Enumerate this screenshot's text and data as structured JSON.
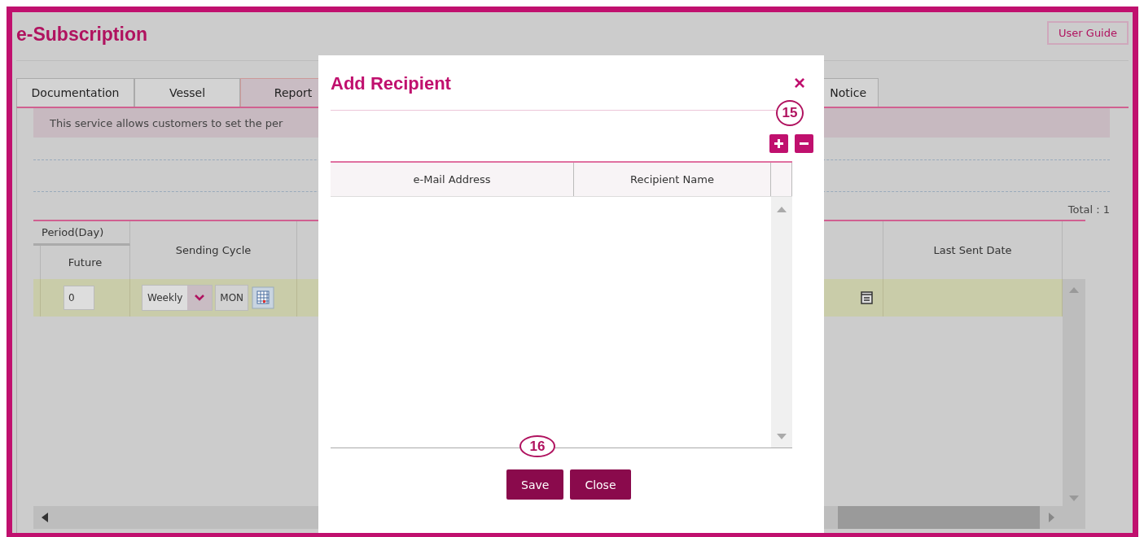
{
  "app": {
    "title": "e-Subscription",
    "user_guide_button": "User Guide"
  },
  "tabs": [
    {
      "label": "Documentation",
      "selected": false
    },
    {
      "label": "Vessel",
      "selected": false
    },
    {
      "label": "Report",
      "selected": true
    },
    {
      "label": "Notice",
      "selected": false
    }
  ],
  "info_text": "This service allows customers to set the per",
  "total": "Total : 1",
  "table": {
    "group_header": "Period(Day)",
    "columns": [
      "Future",
      "Sending Cycle",
      "Last Sent Date"
    ],
    "rows": [
      {
        "future": "0",
        "cycle": "Weekly",
        "day": "MON",
        "last_sent_date": ""
      }
    ]
  },
  "dialog": {
    "title": "Add Recipient",
    "close": "×",
    "columns": [
      "e-Mail Address",
      "Recipient Name"
    ],
    "buttons": [
      "Save",
      "Close"
    ],
    "callouts": [
      {
        "kind": "toolbar",
        "label": "15"
      },
      {
        "kind": "footer",
        "label": "16"
      }
    ]
  }
}
